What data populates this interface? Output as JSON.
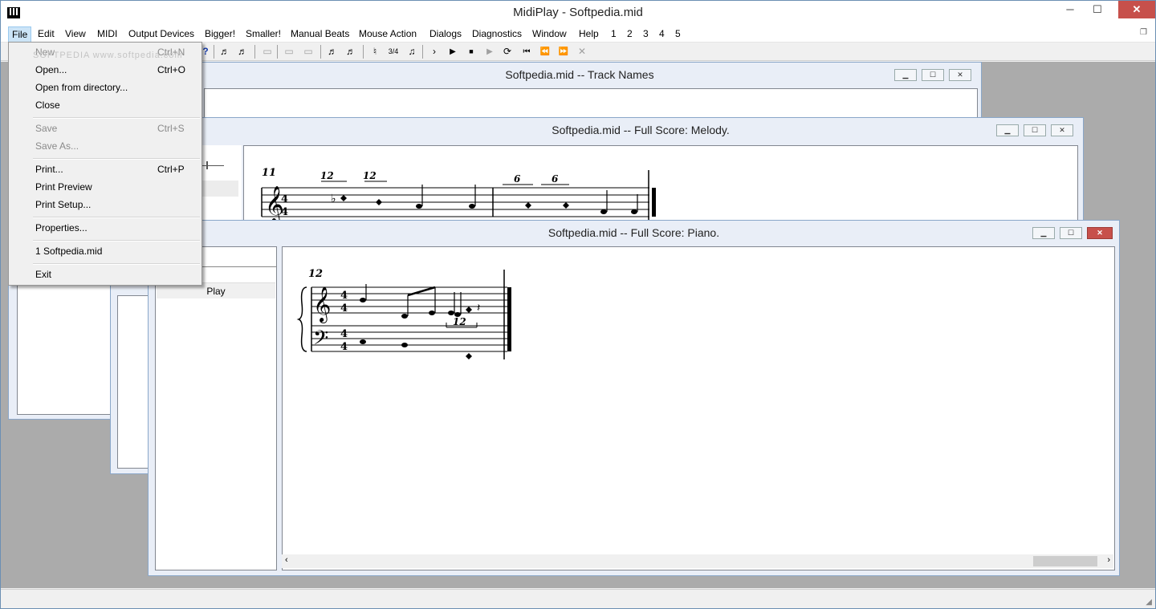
{
  "app": {
    "title": "MidiPlay - Softpedia.mid",
    "minimize": "─",
    "maximize": "☐",
    "close": "✕"
  },
  "menu": [
    "File",
    "Edit",
    "View",
    "MIDI",
    "Output Devices",
    "Bigger!",
    "Smaller!",
    "Manual Beats",
    "Mouse Action",
    "Dialogs",
    "Diagnostics",
    "Window",
    "Help",
    "1",
    "2",
    "3",
    "4",
    "5"
  ],
  "file_menu": {
    "new": {
      "label": "New",
      "shortcut": "Ctrl+N"
    },
    "open": {
      "label": "Open...",
      "shortcut": "Ctrl+O"
    },
    "open_dir": {
      "label": "Open from directory..."
    },
    "close": {
      "label": "Close"
    },
    "save": {
      "label": "Save",
      "shortcut": "Ctrl+S"
    },
    "save_as": {
      "label": "Save As..."
    },
    "print": {
      "label": "Print...",
      "shortcut": "Ctrl+P"
    },
    "print_preview": {
      "label": "Print Preview"
    },
    "print_setup": {
      "label": "Print Setup..."
    },
    "properties": {
      "label": "Properties..."
    },
    "recent1": {
      "label": "1 Softpedia.mid"
    },
    "exit": {
      "label": "Exit"
    }
  },
  "watermark": "SOFTPEDIA www.softpedia.com",
  "toolbar": {
    "icons": [
      "help-icon",
      "tempo-icon",
      "tempo-icon",
      "bars-icon",
      "bars-icon",
      "bars-icon",
      "notes-icon",
      "notes-icon",
      "sharp-icon",
      "time-signature-icon",
      "metronome-icon",
      "play-icon",
      "play-icon",
      "stop-icon",
      "step-icon",
      "loop-icon",
      "to-start-icon",
      "rewind-icon",
      "fast-forward-icon",
      "cancel-icon"
    ],
    "glyphs": [
      "?",
      "♬",
      "♬",
      "▭",
      "▭",
      "▭",
      "♬",
      "♬",
      "♮",
      "3/4",
      "♫",
      "›",
      "▶",
      "■",
      "▶",
      "⟳",
      "⏮",
      "⏪",
      "⏩",
      "✕"
    ]
  },
  "windows": {
    "track_names": {
      "title": "Softpedia.mid -- Track Names"
    },
    "melody": {
      "title": "Softpedia.mid -- Full Score: Melody.",
      "measure_number": "11",
      "tuplets": [
        "12",
        "12",
        "6",
        "6"
      ]
    },
    "piano": {
      "title": "Softpedia.mid -- Full Score: Piano.",
      "measure_number": "12",
      "tuplet": "12",
      "play_label": "Play",
      "time_sig_top": "4",
      "time_sig_bottom": "4"
    }
  },
  "colors": {
    "close_red": "#c7504b",
    "menu_highlight": "#cce4f7",
    "mdi_bg": "#ababab"
  }
}
